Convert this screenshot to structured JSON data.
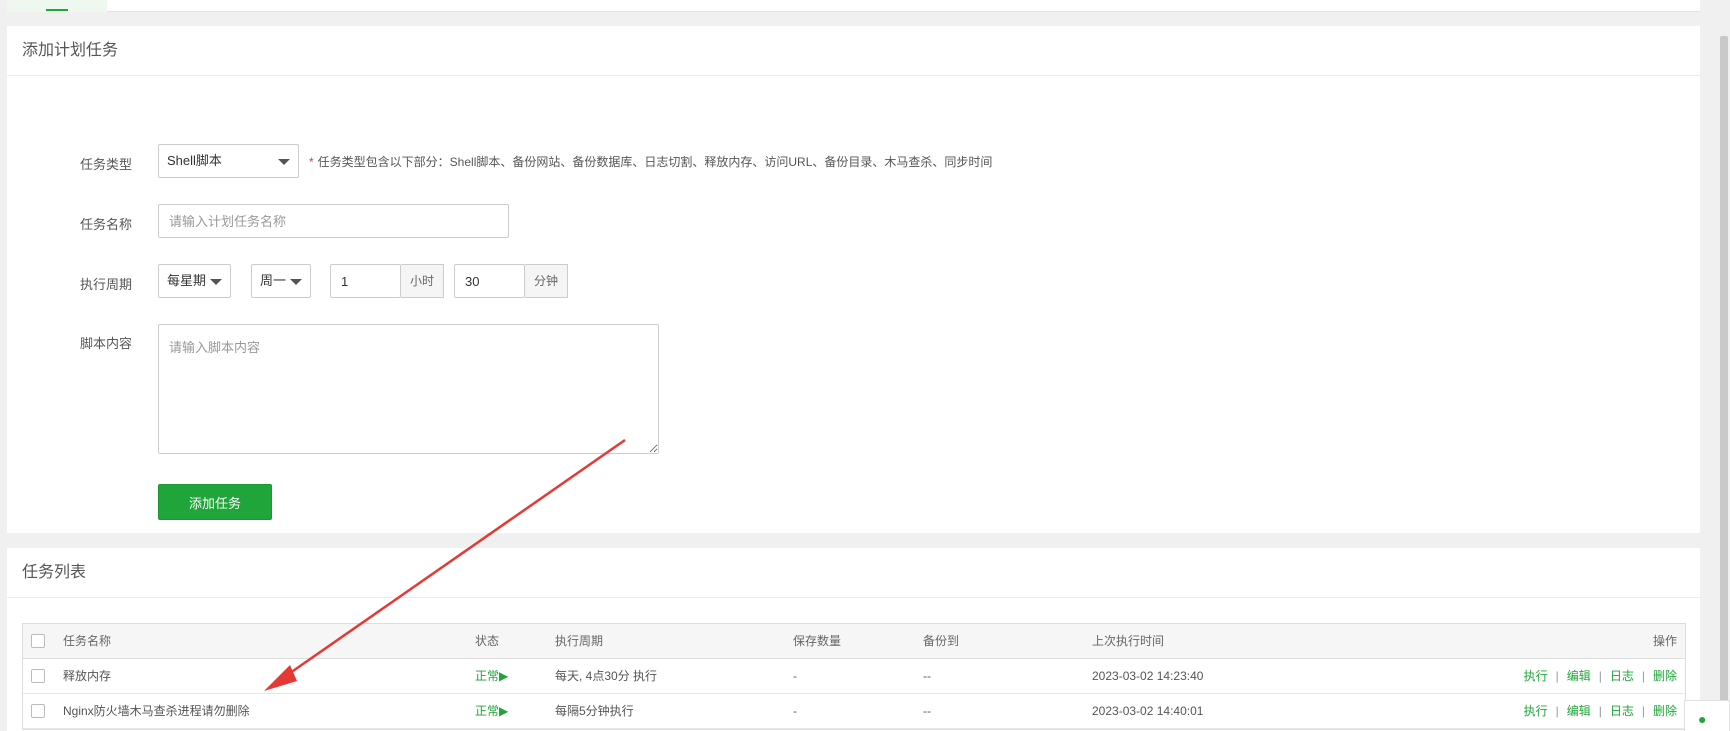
{
  "add_panel": {
    "title": "添加计划任务",
    "task_type": {
      "label": "任务类型",
      "selected": "Shell脚本",
      "hint": "任务类型包含以下部分：Shell脚本、备份网站、备份数据库、日志切割、释放内存、访问URL、备份目录、木马查杀、同步时间"
    },
    "task_name": {
      "label": "任务名称",
      "placeholder": "请输入计划任务名称"
    },
    "period": {
      "label": "执行周期",
      "cycle": "每星期",
      "weekday": "周一",
      "hour_value": "1",
      "hour_unit": "小时",
      "minute_value": "30",
      "minute_unit": "分钟"
    },
    "script": {
      "label": "脚本内容",
      "placeholder": "请输入脚本内容"
    },
    "add_button": "添加任务"
  },
  "list_panel": {
    "title": "任务列表",
    "columns": {
      "name": "任务名称",
      "status": "状态",
      "period": "执行周期",
      "keep": "保存数量",
      "backup_to": "备份到",
      "last_run": "上次执行时间",
      "ops": "操作"
    },
    "rows": [
      {
        "name": "释放内存",
        "status": "正常▶",
        "period": "每天, 4点30分 执行",
        "keep": "-",
        "backup_to": "--",
        "last_run": "2023-03-02 14:23:40"
      },
      {
        "name": "Nginx防火墙木马查杀进程请勿删除",
        "status": "正常▶",
        "period": "每隔5分钟执行",
        "keep": "-",
        "backup_to": "--",
        "last_run": "2023-03-02 14:40:01"
      }
    ],
    "ops": {
      "run": "执行",
      "edit": "编辑",
      "log": "日志",
      "delete": "删除",
      "sep": "|"
    }
  },
  "colors": {
    "accent": "#20a53a",
    "annotation_arrow": "#e53935"
  },
  "icons": {
    "help": "help-chat-icon",
    "caret": "caret-down-icon",
    "checkbox": "checkbox-icon"
  }
}
